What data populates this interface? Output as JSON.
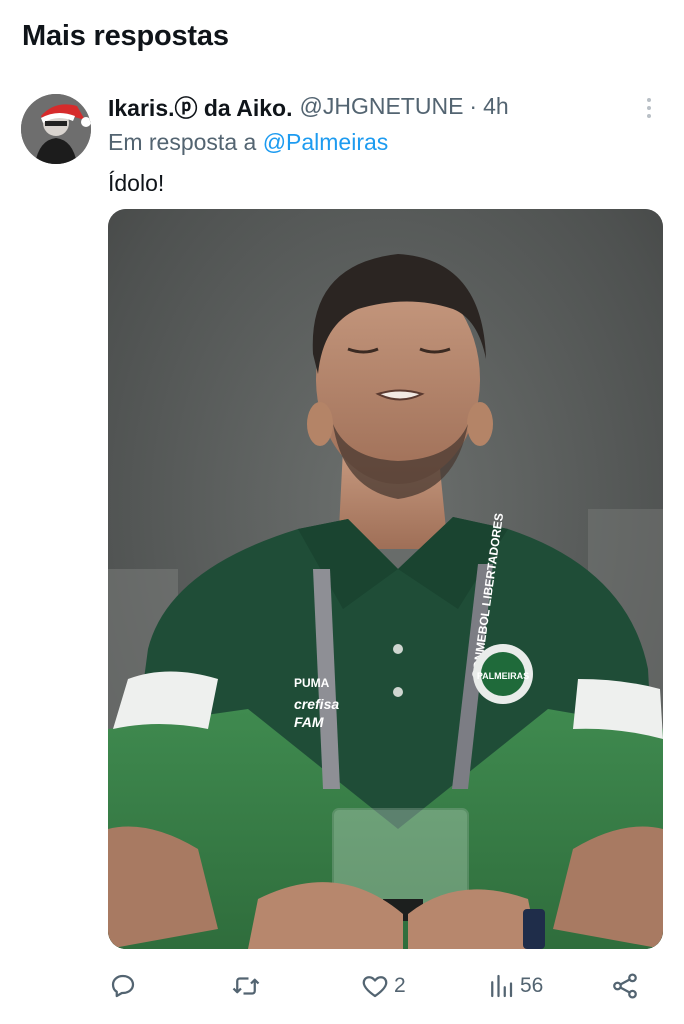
{
  "section": {
    "title": "Mais respostas"
  },
  "tweet": {
    "display_name": "Ikaris.ⓟ da Aiko.",
    "handle": "@JHGNETUNE",
    "separator": "·",
    "time": "4h",
    "reply_prefix": "Em resposta a",
    "reply_mention": "@Palmeiras",
    "text": "Ídolo!"
  },
  "media": {
    "shirt_brand_text": "PUMA",
    "shirt_sponsor_text": "crefisa",
    "shirt_sponsor_text_2": "FAM",
    "lanyard_text": "CONMEBOL LIBERTADORES",
    "crest_text": "PALMEIRAS"
  },
  "actions": {
    "reply_icon": "reply-icon",
    "retweet_icon": "retweet-icon",
    "like_icon": "heart-icon",
    "like_count": "2",
    "views_icon": "views-icon",
    "views_count": "56",
    "share_icon": "share-icon"
  },
  "colors": {
    "text_primary": "#0f1419",
    "text_secondary": "#536471",
    "link": "#1d9bf0"
  }
}
